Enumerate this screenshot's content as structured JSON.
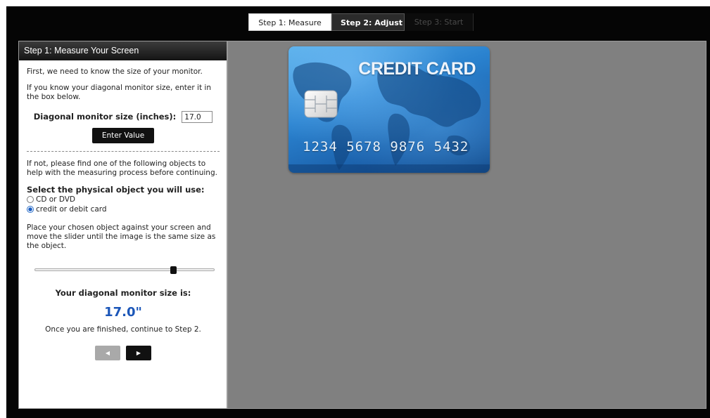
{
  "steps": [
    {
      "label": "Step 1: Measure"
    },
    {
      "label": "Step 2: Adjust"
    },
    {
      "label": "Step 3: Start"
    }
  ],
  "panel": {
    "title": "Step 1: Measure Your Screen",
    "intro": "First, we need to know the size of your monitor.",
    "know_size": "If you know your diagonal monitor size, enter it in the box below.",
    "diag_label": "Diagonal monitor size (inches):",
    "diag_value": "17.0",
    "enter_button": "Enter Value",
    "find_object": "If not, please find one of the following objects to help with the measuring process before continuing.",
    "select_label": "Select the physical object you will use:",
    "options": [
      {
        "label": "CD or DVD",
        "selected": false
      },
      {
        "label": "credit or debit card",
        "selected": true
      }
    ],
    "instructions": "Place your chosen object against your screen and move the slider until the image is the same size as the object.",
    "slider_value": 0.77,
    "result_label": "Your diagonal monitor size is:",
    "result_value": "17.0\"",
    "finish_text": "Once you are finished, continue to Step 2.",
    "prev_icon": "left-arrow-icon",
    "next_icon": "right-arrow-icon"
  },
  "card": {
    "title": "CREDIT CARD",
    "number": "1234  5678  9876  5432",
    "chip_icon": "chip-icon",
    "map_icon": "world-map-icon"
  },
  "colors": {
    "accent_blue": "#1b56b8",
    "canvas_gray": "#808080",
    "frame_black": "#050505"
  }
}
